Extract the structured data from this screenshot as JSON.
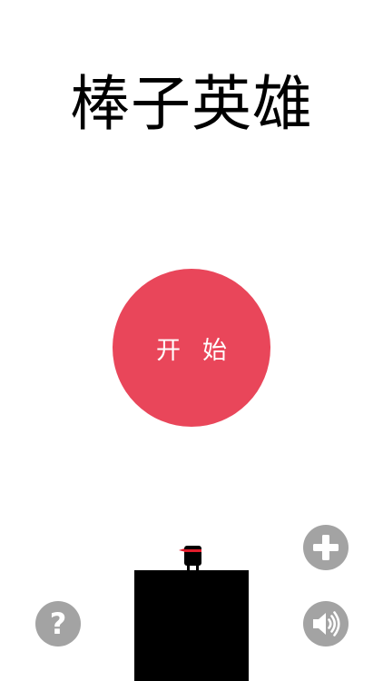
{
  "game": {
    "title": "棒子英雄",
    "start_label": "开始"
  },
  "icons": {
    "help": "question-mark-icon",
    "add": "plus-icon",
    "sound": "speaker-icon"
  },
  "help_glyph": "?",
  "colors": {
    "accent": "#e9465a",
    "button_gray": "#a3a3a3",
    "pillar": "#000000",
    "headband": "#e21d2c",
    "background": "#ffffff"
  }
}
